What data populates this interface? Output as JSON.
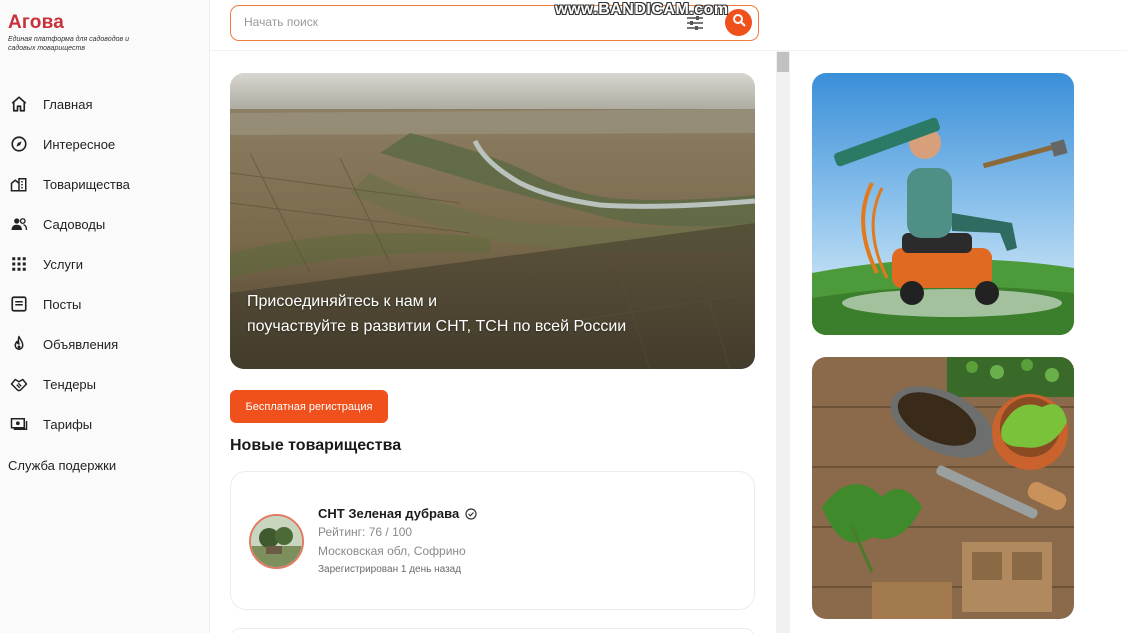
{
  "brand": {
    "name": "Агова",
    "tagline": "Единая платформа для садоводов и садовых товариществ"
  },
  "search": {
    "placeholder": "Начать поиск"
  },
  "watermark": "www.BANDICAM.com",
  "sidebar": {
    "items": [
      {
        "label": "Главная",
        "icon": "home-icon"
      },
      {
        "label": "Интересное",
        "icon": "compass-icon"
      },
      {
        "label": "Товарищества",
        "icon": "buildings-icon"
      },
      {
        "label": "Садоводы",
        "icon": "people-icon"
      },
      {
        "label": "Услуги",
        "icon": "grid-icon"
      },
      {
        "label": "Посты",
        "icon": "posts-icon"
      },
      {
        "label": "Объявления",
        "icon": "fire-icon"
      },
      {
        "label": "Тендеры",
        "icon": "handshake-icon"
      },
      {
        "label": "Тарифы",
        "icon": "money-icon"
      }
    ],
    "support_label": "Служба подержки"
  },
  "hero": {
    "line1": "Присоединяйтесь к нам и",
    "line2": "поучаствуйте в развитии СНТ, ТСН по всей России"
  },
  "cta_label": "Бесплатная регистрация",
  "section_title": "Новые товарищества",
  "card": {
    "title": "СНТ Зеленая дубрава",
    "rating": "Рейтинг: 76 / 100",
    "location": "Московская обл, Софрино",
    "registered": "Зарегистрирован 1 день назад"
  },
  "colors": {
    "accent": "#f0501c",
    "brand": "#c8303a"
  }
}
